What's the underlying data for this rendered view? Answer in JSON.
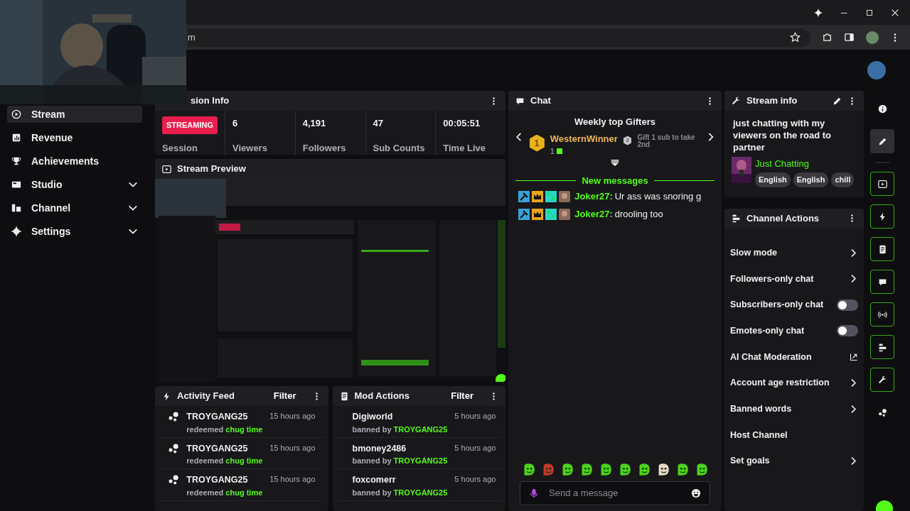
{
  "browser": {
    "url": "m"
  },
  "sidebar": {
    "items": [
      {
        "label": "Stream",
        "kind": "link",
        "selected": true
      },
      {
        "label": "Revenue",
        "kind": "link",
        "selected": false
      },
      {
        "label": "Achievements",
        "kind": "link",
        "selected": false
      },
      {
        "label": "Studio",
        "kind": "group",
        "selected": false
      },
      {
        "label": "Channel",
        "kind": "group",
        "selected": false
      },
      {
        "label": "Settings",
        "kind": "group",
        "selected": false
      }
    ]
  },
  "session_info": {
    "title": "sion Info",
    "status": "STREAMING",
    "status_label": "Session",
    "stats": [
      {
        "value": "6",
        "label": "Viewers"
      },
      {
        "value": "4,191",
        "label": "Followers"
      },
      {
        "value": "47",
        "label": "Sub Counts"
      },
      {
        "value": "00:05:51",
        "label": "Time Live"
      }
    ]
  },
  "stream_preview": {
    "title": "Stream Preview",
    "kind": "picture"
  },
  "activity_feed": {
    "title": "Activity Feed",
    "filter": "Filter",
    "items": [
      {
        "user": "TROYGANG25",
        "action": "redeemed",
        "target": "chug time",
        "time": "15 hours ago"
      },
      {
        "user": "TROYGANG25",
        "action": "redeemed",
        "target": "chug time",
        "time": "15 hours ago"
      },
      {
        "user": "TROYGANG25",
        "action": "redeemed",
        "target": "chug time",
        "time": "15 hours ago"
      }
    ]
  },
  "mod_actions": {
    "title": "Mod Actions",
    "filter": "Filter",
    "items": [
      {
        "user": "Digiworld",
        "action": "banned by",
        "target": "TROYGANG25",
        "time": "5 hours ago"
      },
      {
        "user": "bmoney2486",
        "action": "banned by",
        "target": "TROYGANG25",
        "time": "5 hours ago"
      },
      {
        "user": "foxcomerr",
        "action": "banned by",
        "target": "TROYGANG25",
        "time": "5 hours ago"
      }
    ]
  },
  "chat": {
    "title": "Chat",
    "gifters_title": "Weekly top Gifters",
    "top_gifter": {
      "rank": "1",
      "name": "WesternWinner",
      "count": "1"
    },
    "next_gifter": {
      "rank": "2",
      "text": "Gift 1 sub to take 2nd"
    },
    "new_messages": "New messages",
    "messages": [
      {
        "user": "Joker27:",
        "text": "Ur ass was snoring g"
      },
      {
        "user": "Joker27:",
        "text": "drooling too"
      }
    ],
    "input": {
      "placeholder": "Send a message"
    }
  },
  "stream_info": {
    "title": "Stream info",
    "description": "just chatting with my viewers on the road to partner",
    "category": "Just Chatting",
    "tags": [
      "English",
      "English",
      "chill"
    ]
  },
  "channel_actions": {
    "title": "Channel Actions",
    "items": [
      {
        "label": "Slow mode",
        "kind": "arrow"
      },
      {
        "label": "Followers-only chat",
        "kind": "arrow"
      },
      {
        "label": "Subscribers-only chat",
        "kind": "toggle",
        "on": false
      },
      {
        "label": "Emotes-only chat",
        "kind": "toggle",
        "on": false
      },
      {
        "label": "AI Chat Moderation",
        "kind": "external"
      },
      {
        "label": "Account age restriction",
        "kind": "arrow"
      },
      {
        "label": "Banned words",
        "kind": "arrow"
      },
      {
        "label": "Host Channel",
        "kind": "plain"
      },
      {
        "label": "Set goals",
        "kind": "arrow"
      }
    ]
  },
  "rail": [
    {
      "kind": "plain",
      "selected": false
    },
    {
      "kind": "plain",
      "selected": true
    },
    {
      "kind": "framed",
      "selected": false
    },
    {
      "kind": "framed",
      "selected": false
    },
    {
      "kind": "framed",
      "selected": false
    },
    {
      "kind": "framed",
      "selected": false
    },
    {
      "kind": "framed",
      "selected": false
    },
    {
      "kind": "framed",
      "selected": false
    },
    {
      "kind": "framed",
      "selected": false
    },
    {
      "kind": "plain",
      "selected": false
    }
  ]
}
